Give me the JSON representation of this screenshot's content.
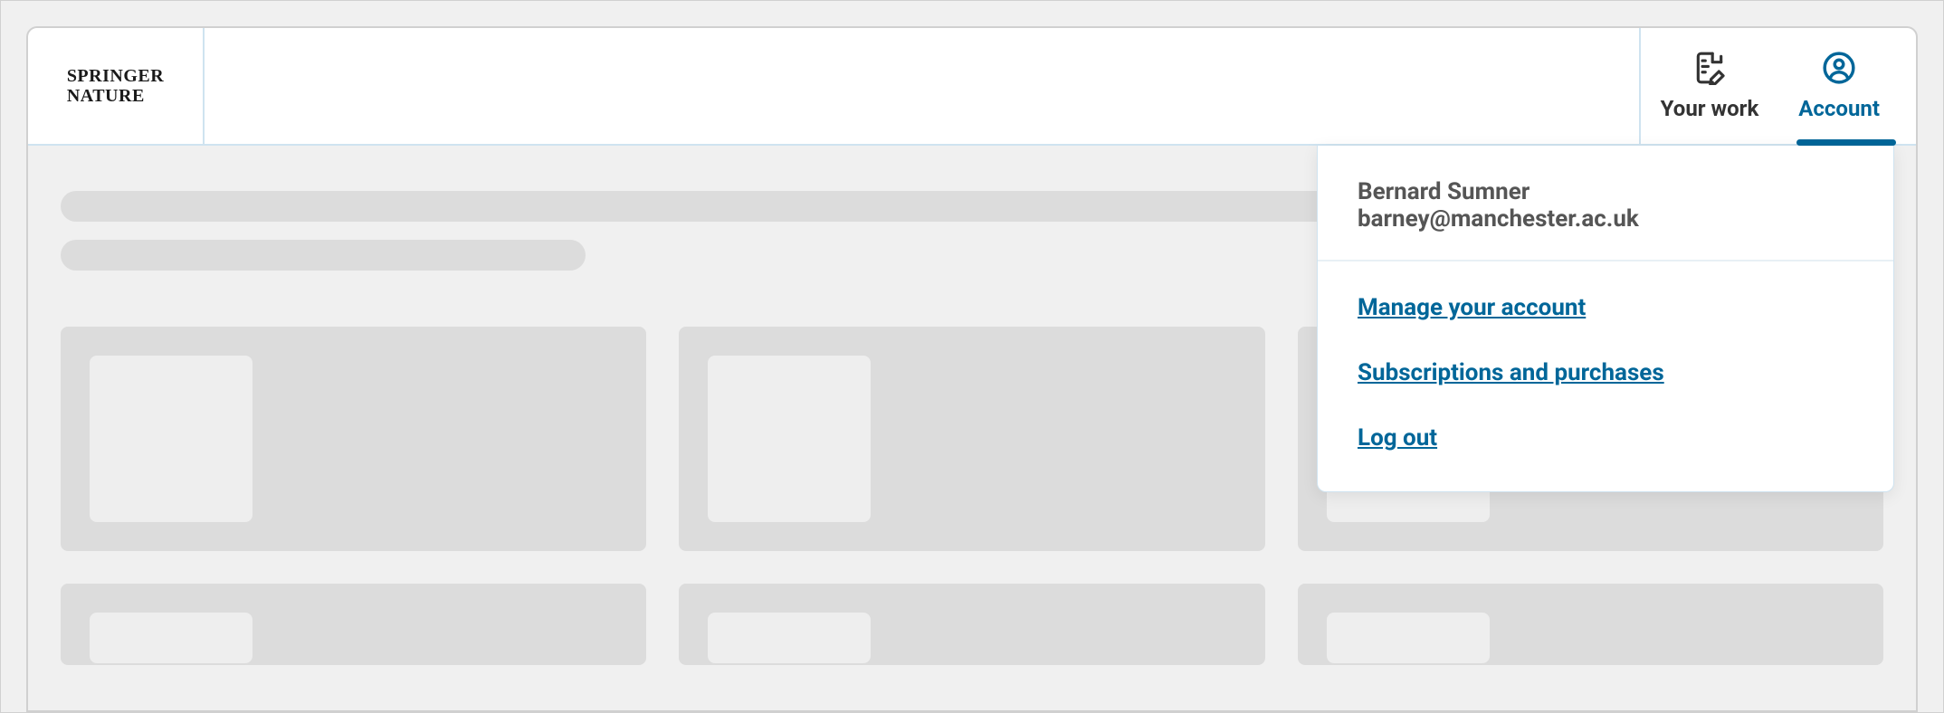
{
  "logo": {
    "line1": "Springer",
    "line2": "Nature"
  },
  "nav": {
    "your_work": "Your work",
    "account": "Account"
  },
  "dropdown": {
    "name": "Bernard Sumner",
    "email": "barney@manchester.ac.uk",
    "manage": "Manage your account",
    "subscriptions": "Subscriptions and purchases",
    "logout": "Log out"
  }
}
